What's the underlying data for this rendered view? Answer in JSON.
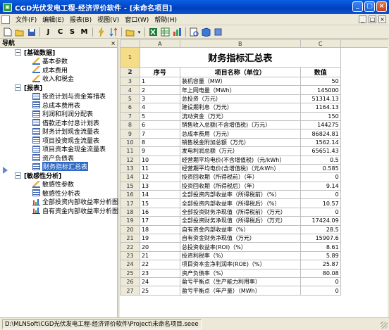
{
  "window": {
    "title": "CGD光伏发电工程-经济评价软件 - [未命名项目]",
    "buttons": [
      "_",
      "□",
      "×"
    ]
  },
  "menubar": {
    "items": [
      "文件(F)",
      "编辑(E)",
      "报表(B)",
      "视图(V)",
      "窗口(W)",
      "帮助(H)"
    ],
    "right_buttons": [
      "_",
      "□",
      "×"
    ]
  },
  "toolbar": {
    "items": [
      "J",
      "C",
      "S",
      "M"
    ]
  },
  "nav": {
    "header": "导航",
    "pin": "×",
    "groups": [
      {
        "label": "[基础数据]",
        "items": [
          "基本参数",
          "成本费用",
          "收入和税金"
        ]
      },
      {
        "label": "[报表]",
        "items": [
          "投资计划与资金筹措表",
          "总成本费用表",
          "利润和利润分配表",
          "借款还本付息计划表",
          "财务计划现金流量表",
          "项目投资现金流量表",
          "项目资本金现金流量表",
          "资产负债表",
          "财务指标汇总表"
        ]
      },
      {
        "label": "[敏感性分析]",
        "items": [
          "敏感性参数",
          "敏感性分析表",
          "全部投资内部收益率分析图",
          "自有资金内部收益率分析图"
        ]
      }
    ],
    "selected": "财务指标汇总表"
  },
  "sheet": {
    "columns": [
      "A",
      "B",
      "C"
    ],
    "title": "财务指标汇总表",
    "headers": [
      "序号",
      "项目名称（单位）",
      "数值"
    ],
    "rows": [
      [
        "1",
        "装机容量（MW）",
        "50"
      ],
      [
        "2",
        "年上网电量（MWh）",
        "145000"
      ],
      [
        "3",
        "总投资（万元）",
        "51314.13"
      ],
      [
        "4",
        "建设期利息（万元）",
        "1164.13"
      ],
      [
        "5",
        "流动资金（万元）",
        "150"
      ],
      [
        "6",
        "销售收入总额(不含增值税)（万元）",
        "144275"
      ],
      [
        "7",
        "总成本费用（万元）",
        "86824.81"
      ],
      [
        "8",
        "销售税金附加总额（万元）",
        "1562.14"
      ],
      [
        "9",
        "发电利润总额（万元）",
        "65651.43"
      ],
      [
        "10",
        "经营期平均电价(不含增值税)（元/kWh）",
        "0.5"
      ],
      [
        "11",
        "经营期平均电价(含增值税)（元/kWh）",
        "0.585"
      ],
      [
        "12",
        "投资回收期（所得税前）（年）",
        "0"
      ],
      [
        "13",
        "投资回收期（所得税后）（年）",
        "9.14"
      ],
      [
        "14",
        "全部投资内部收益率（所得税前）（%）",
        "0"
      ],
      [
        "15",
        "全部投资内部收益率（所得税后）（%）",
        "10.57"
      ],
      [
        "16",
        "全部投资财务净现值（所得税前）（万元）",
        "0"
      ],
      [
        "17",
        "全部投资财务净现值（所得税后）（万元）",
        "17424.09"
      ],
      [
        "18",
        "自有资金内部收益率（%）",
        "28.5"
      ],
      [
        "19",
        "自有资金财务净现值（万元）",
        "15907.6"
      ],
      [
        "20",
        "总投资收益率(ROI)（%）",
        "8.61"
      ],
      [
        "21",
        "投资利税率（%）",
        "5.89"
      ],
      [
        "22",
        "项目资本金净利润率(ROE)（%）",
        "25.87"
      ],
      [
        "23",
        "资产负债率（%）",
        "80.08"
      ],
      [
        "24",
        "盈亏平衡点（生产能力利用率）",
        "0"
      ],
      [
        "25",
        "盈亏平衡点（年产量）（MWh）",
        "0"
      ]
    ]
  },
  "status": {
    "path": "D:\\MLNSoft\\CGD光伏发电工程-经济评价软件\\Project\\未命名项目.seee"
  }
}
